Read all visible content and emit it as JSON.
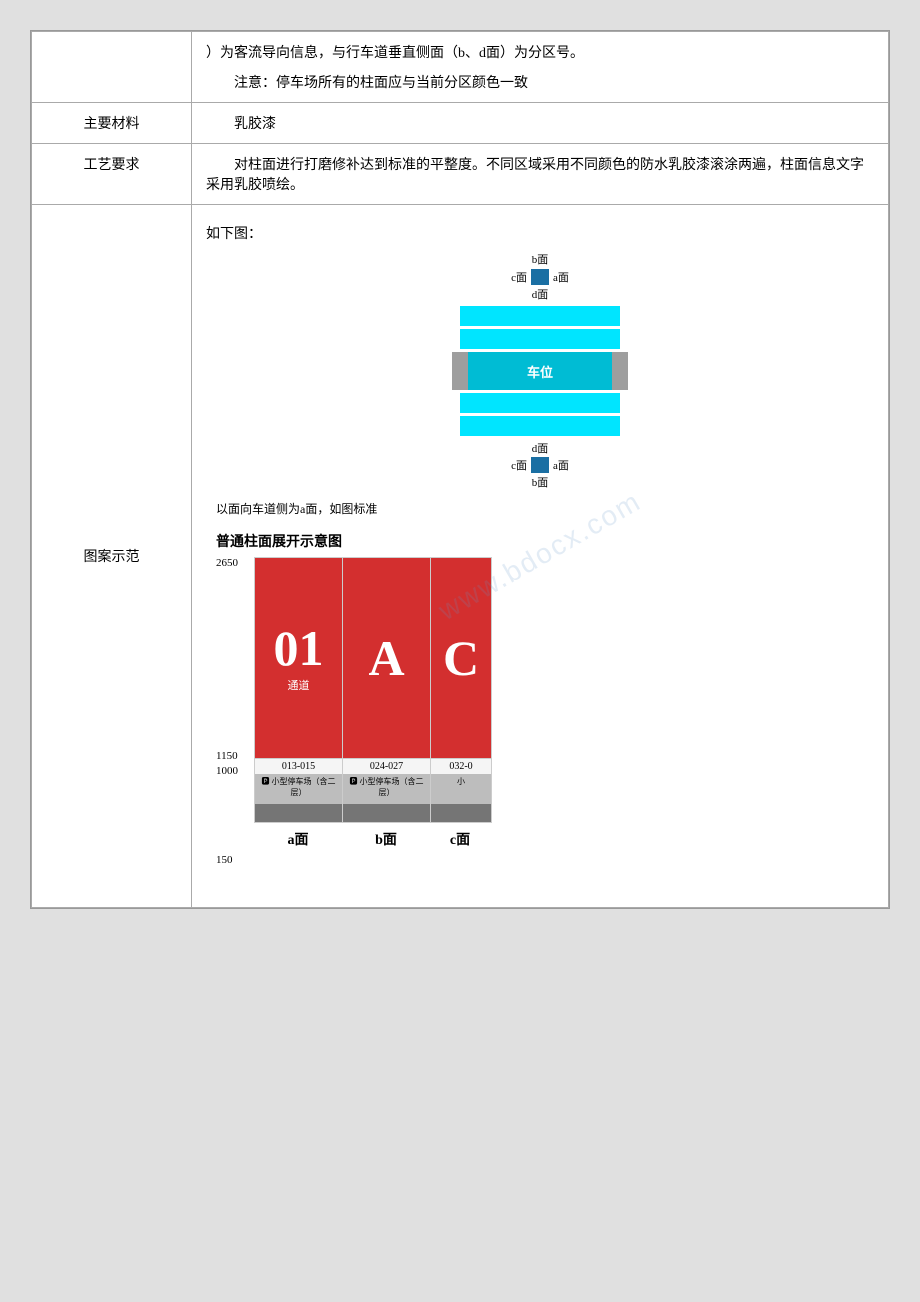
{
  "rows": [
    {
      "id": "row-description",
      "left": "",
      "right_type": "text",
      "right_content": "）为客流导向信息，与行车道垂直侧面（b、d面）为分区号。\n注意：停车场所有的柱面应与当前分区颜色一致"
    },
    {
      "id": "row-material",
      "left": "主要材料",
      "right_type": "text",
      "right_content": "乳胶漆"
    },
    {
      "id": "row-craft",
      "left": "工艺要求",
      "right_type": "text",
      "right_content": "对柱面进行打磨修补达到标准的平整度。不同区域采用不同颜色的防水乳胶漆滚涂两遍，柱面信文字采用乳胶喷绘。"
    },
    {
      "id": "row-diagram",
      "left": "图案示范",
      "right_type": "diagram"
    }
  ],
  "diagram": {
    "intro_label": "如下图：",
    "face_labels_top": {
      "b_face": "b面",
      "c_face": "c面",
      "a_face": "a面",
      "d_face": "d面"
    },
    "car_space_label": "车位",
    "face_note": "以面向车道侧为a面，如图标准",
    "unfold_title": "普通柱面展开示意图",
    "dimension_2650": "2650",
    "dimension_1150": "1150",
    "dimension_1000": "1000",
    "dimension_150": "150",
    "columns": [
      {
        "big_label": "01",
        "sub_label": "通道",
        "range": "013-015",
        "parking_info": "小型停车场（含二层）",
        "face": "a面"
      },
      {
        "big_label": "A",
        "sub_label": "",
        "range": "024-027",
        "parking_info": "小型停车场（含二层）",
        "face": "b面"
      },
      {
        "big_label": "C",
        "sub_label": "",
        "range": "032-0",
        "parking_info": "小",
        "face": "c面"
      }
    ],
    "watermark": "www.bdocx.com"
  },
  "labels": {
    "material_label": "主要材料",
    "craft_label": "工艺要求",
    "diagram_label": "图案示范",
    "material_value": "乳胶漆",
    "craft_text": "对柱面进行打磨修补达到标准的平整度。不同区域采用不同颜色的防水乳胶漆滚涂两遍，柱面信文字采用乳胶喷绘。",
    "intro_text": "如下图：",
    "face_note_text": "以面向车道侧为a面，如图标准",
    "unfold_title_text": "普通柱面展开示意图"
  }
}
